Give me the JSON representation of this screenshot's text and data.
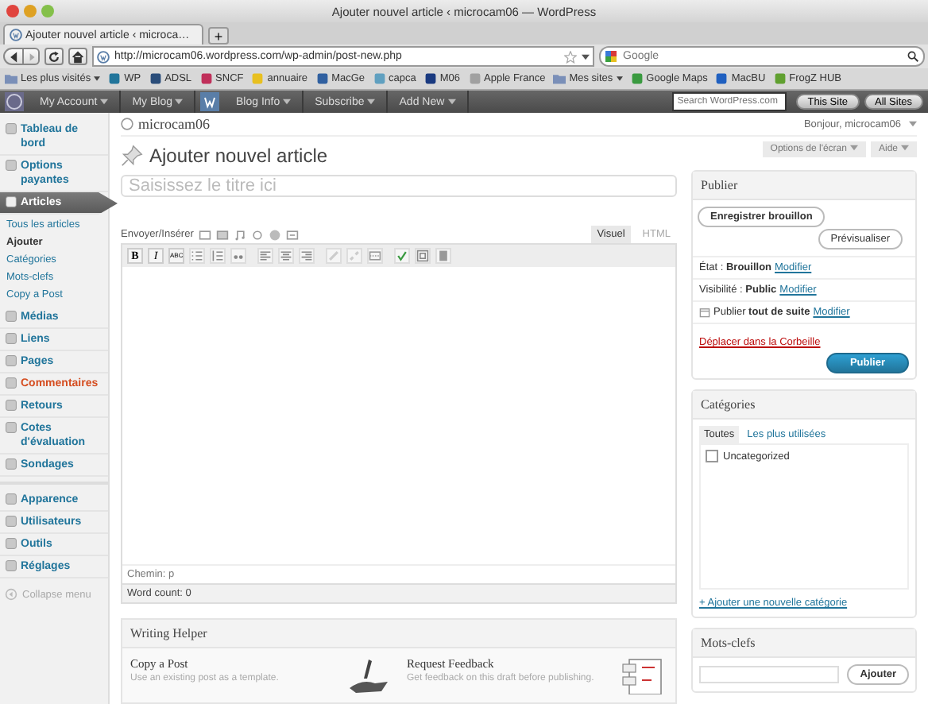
{
  "window": {
    "title": "Ajouter nouvel article ‹ microcam06 — WordPress"
  },
  "browser_tabs": [
    {
      "label": "Ajouter nouvel article ‹ microca…",
      "selected": true
    }
  ],
  "new_tab": "+",
  "address": {
    "value": "http://microcam06.wordpress.com/wp-admin/post-new.php"
  },
  "search": {
    "placeholder": "Google"
  },
  "bookmarks": [
    {
      "label": "Les plus visités",
      "kind": "folder",
      "color": "#7a8fb8"
    },
    {
      "label": "WP",
      "kind": "site",
      "color": "#21759b"
    },
    {
      "label": "ADSL",
      "kind": "site",
      "color": "#2a4d7a"
    },
    {
      "label": "SNCF",
      "kind": "site",
      "color": "#c0305a"
    },
    {
      "label": "annuaire",
      "kind": "site",
      "color": "#e8c020"
    },
    {
      "label": "MacGe",
      "kind": "site",
      "color": "#3060a0"
    },
    {
      "label": "capca",
      "kind": "site",
      "color": "#60a0c0"
    },
    {
      "label": "M06",
      "kind": "site",
      "color": "#1a3a80"
    },
    {
      "label": "Apple France",
      "kind": "site",
      "color": "#a0a0a0"
    },
    {
      "label": "Mes sites",
      "kind": "folder",
      "color": "#7a8fb8"
    },
    {
      "label": "Google Maps",
      "kind": "site",
      "color": "#3a9a40"
    },
    {
      "label": "MacBU",
      "kind": "site",
      "color": "#2060c0"
    },
    {
      "label": "FrogZ HUB",
      "kind": "site",
      "color": "#60a030"
    }
  ],
  "admin_bar": {
    "menus": [
      "My Account",
      "My Blog",
      "Blog Info",
      "Subscribe",
      "Add New"
    ],
    "search": {
      "placeholder": "Search WordPress.com"
    },
    "buttons": [
      "This Site",
      "All Sites"
    ]
  },
  "sidebar": {
    "items": [
      {
        "label": "Tableau de bord",
        "selected": false,
        "hovered": false
      },
      {
        "label": "Options payantes",
        "selected": false,
        "hovered": false
      },
      {
        "label": "Articles",
        "selected": true,
        "hovered": false,
        "children": [
          {
            "label": "Tous les articles",
            "selected": false
          },
          {
            "label": "Ajouter",
            "selected": true
          },
          {
            "label": "Catégories",
            "selected": false
          },
          {
            "label": "Mots-clefs",
            "selected": false
          },
          {
            "label": "Copy a Post",
            "selected": false
          }
        ]
      },
      {
        "label": "Médias",
        "selected": false,
        "hovered": false
      },
      {
        "label": "Liens",
        "selected": false,
        "hovered": false
      },
      {
        "label": "Pages",
        "selected": false,
        "hovered": false
      },
      {
        "label": "Commentaires",
        "selected": false,
        "hovered": true
      },
      {
        "label": "Retours",
        "selected": false,
        "hovered": false
      },
      {
        "label": "Cotes d'évaluation",
        "selected": false,
        "hovered": false
      },
      {
        "label": "Sondages",
        "selected": false,
        "hovered": false
      },
      {
        "label": "Apparence",
        "selected": false,
        "hovered": false
      },
      {
        "label": "Utilisateurs",
        "selected": false,
        "hovered": false
      },
      {
        "label": "Outils",
        "selected": false,
        "hovered": false
      },
      {
        "label": "Réglages",
        "selected": false,
        "hovered": false
      }
    ],
    "collapse": "Collapse menu"
  },
  "header": {
    "site": "microcam06",
    "greeting": "Bonjour, microcam06",
    "buttons": [
      "Options de l'écran",
      "Aide"
    ]
  },
  "page_title": "Ajouter nouvel article",
  "title_field": {
    "placeholder": "Saisissez le titre ici"
  },
  "editor": {
    "upload_label": "Envoyer/Insérer",
    "tabs": [
      {
        "label": "Visuel",
        "selected": true
      },
      {
        "label": "HTML",
        "selected": false
      }
    ],
    "text_buttons": [
      "B",
      "I",
      "ABC"
    ],
    "path": "Chemin: p",
    "word_count": "Word count: 0"
  },
  "writing_helper": {
    "title": "Writing Helper",
    "items": [
      {
        "title": "Copy a Post",
        "description": "Use an existing post as a template."
      },
      {
        "title": "Request Feedback",
        "description": "Get feedback on this draft before publishing."
      }
    ]
  },
  "publish": {
    "title": "Publier",
    "save": "Enregistrer brouillon",
    "preview": "Prévisualiser",
    "rows": [
      {
        "label": "État :",
        "value": "Brouillon",
        "link": "Modifier",
        "kind": "text"
      },
      {
        "label": "Visibilité :",
        "value": "Public",
        "link": "Modifier",
        "kind": "text"
      },
      {
        "label": "Publier",
        "value": "tout de suite",
        "link": "Modifier",
        "kind": "calendar"
      }
    ],
    "trash": "Déplacer dans la Corbeille",
    "submit": "Publier"
  },
  "categories": {
    "title": "Catégories",
    "tabs": [
      {
        "label": "Toutes",
        "selected": true
      },
      {
        "label": "Les plus utilisées",
        "selected": false
      }
    ],
    "items": [
      {
        "label": "Uncategorized",
        "checked": false
      }
    ],
    "add_link": "+ Ajouter une nouvelle catégorie"
  },
  "tags": {
    "title": "Mots-clefs",
    "button": "Ajouter"
  }
}
